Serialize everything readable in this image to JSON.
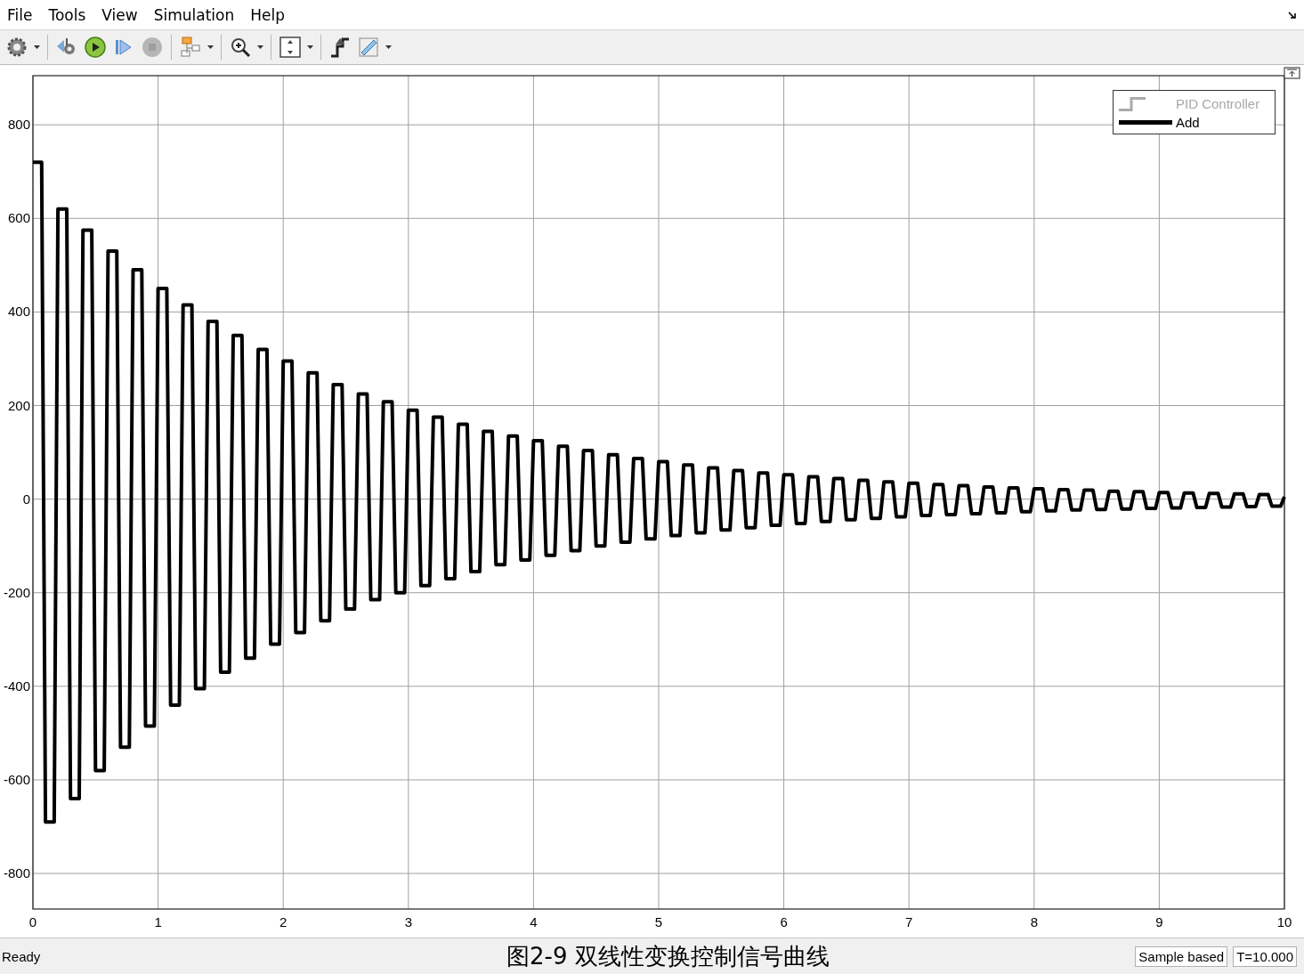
{
  "menu": [
    "File",
    "Tools",
    "View",
    "Simulation",
    "Help"
  ],
  "toolbar": [
    {
      "kind": "settings",
      "dropdown": true,
      "disabled": false
    },
    {
      "kind": "step-back",
      "dropdown": false,
      "disabled": false
    },
    {
      "kind": "run",
      "dropdown": false,
      "disabled": false
    },
    {
      "kind": "step-forward",
      "dropdown": false,
      "disabled": false
    },
    {
      "kind": "stop",
      "dropdown": false,
      "disabled": true
    },
    {
      "kind": "highlight",
      "dropdown": true,
      "disabled": false
    },
    {
      "kind": "zoom",
      "dropdown": true,
      "disabled": false
    },
    {
      "kind": "fit",
      "dropdown": true,
      "disabled": false
    },
    {
      "kind": "signal",
      "dropdown": false,
      "disabled": false
    },
    {
      "kind": "ruler",
      "dropdown": true,
      "disabled": false
    }
  ],
  "legend": [
    {
      "label": "PID Controller",
      "enabled": false
    }
  ],
  "plot": {
    "chart_data": {
      "type": "line",
      "grid": true,
      "xlim": [
        0,
        10
      ],
      "ylim": [
        -876,
        905
      ],
      "xticks": [
        0,
        1,
        2,
        3,
        4,
        5,
        6,
        7,
        8,
        9,
        10
      ],
      "yticks": [
        -800,
        -600,
        -400,
        -200,
        0,
        200,
        400,
        600,
        800
      ],
      "series": [
        {
          "name": "Add",
          "color": "#000000",
          "x": [
            0,
            0.07,
            0.1,
            0.17,
            0.2,
            0.27,
            0.3,
            0.37,
            0.4,
            0.47,
            0.5,
            0.57,
            0.6,
            0.67,
            0.7,
            0.77,
            0.8,
            0.87,
            0.9,
            0.97,
            1,
            1.07,
            1.1,
            1.17,
            1.2,
            1.27,
            1.3,
            1.37,
            1.4,
            1.47,
            1.5,
            1.57,
            1.6,
            1.67,
            1.7,
            1.77,
            1.8,
            1.87,
            1.9,
            1.97,
            2,
            2.07,
            2.1,
            2.17,
            2.2,
            2.27,
            2.3,
            2.37,
            2.4,
            2.47,
            2.5,
            2.57,
            2.6,
            2.67,
            2.7,
            2.77,
            2.8,
            2.87,
            2.9,
            2.97,
            3,
            3.07,
            3.1,
            3.17,
            3.2,
            3.27,
            3.3,
            3.37,
            3.4,
            3.47,
            3.5,
            3.57,
            3.6,
            3.67,
            3.7,
            3.77,
            3.8,
            3.87,
            3.9,
            3.97,
            4,
            4.07,
            4.1,
            4.17,
            4.2,
            4.27,
            4.3,
            4.37,
            4.4,
            4.47,
            4.5,
            4.57,
            4.6,
            4.67,
            4.7,
            4.77,
            4.8,
            4.87,
            4.9,
            4.97,
            5,
            5.07,
            5.1,
            5.17,
            5.2,
            5.27,
            5.3,
            5.37,
            5.4,
            5.47,
            5.5,
            5.57,
            5.6,
            5.67,
            5.7,
            5.77,
            5.8,
            5.87,
            5.9,
            5.97,
            6,
            6.07,
            6.1,
            6.17,
            6.2,
            6.27,
            6.3,
            6.37,
            6.4,
            6.47,
            6.5,
            6.57,
            6.6,
            6.67,
            6.7,
            6.77,
            6.8,
            6.87,
            6.9,
            6.97,
            7,
            7.07,
            7.1,
            7.17,
            7.2,
            7.27,
            7.3,
            7.37,
            7.4,
            7.47,
            7.5,
            7.57,
            7.6,
            7.67,
            7.7,
            7.77,
            7.8,
            7.87,
            7.9,
            7.97,
            8,
            8.07,
            8.1,
            8.17,
            8.2,
            8.27,
            8.3,
            8.37,
            8.4,
            8.47,
            8.5,
            8.57,
            8.6,
            8.67,
            8.7,
            8.77,
            8.8,
            8.87,
            8.9,
            8.97,
            9,
            9.07,
            9.1,
            9.17,
            9.2,
            9.27,
            9.3,
            9.37,
            9.4,
            9.47,
            9.5,
            9.57,
            9.6,
            9.67,
            9.7,
            9.77,
            9.8,
            9.87,
            9.9,
            9.97,
            10
          ],
          "values": [
            720,
            720,
            -690,
            -690,
            620,
            620,
            -640,
            -640,
            575,
            575,
            -580,
            -580,
            530,
            530,
            -530,
            -530,
            490,
            490,
            -485,
            -485,
            450,
            450,
            -440,
            -440,
            415,
            415,
            -405,
            -405,
            380,
            380,
            -370,
            -370,
            350,
            350,
            -340,
            -340,
            320,
            320,
            -310,
            -310,
            295,
            295,
            -285,
            -285,
            270,
            270,
            -260,
            -260,
            245,
            245,
            -235,
            -235,
            225,
            225,
            -215,
            -215,
            208,
            208,
            -200,
            -200,
            190,
            190,
            -185,
            -185,
            175,
            175,
            -170,
            -170,
            160,
            160,
            -155,
            -155,
            145,
            145,
            -140,
            -140,
            135,
            135,
            -130,
            -130,
            125,
            125,
            -120,
            -120,
            113,
            113,
            -110,
            -110,
            104,
            104,
            -100,
            -100,
            95,
            95,
            -92,
            -92,
            87,
            87,
            -85,
            -85,
            80,
            80,
            -78,
            -78,
            73,
            73,
            -72,
            -72,
            67,
            67,
            -66,
            -66,
            61,
            61,
            -61,
            -61,
            56,
            56,
            -56,
            -56,
            52,
            52,
            -52,
            -52,
            48,
            48,
            -48,
            -48,
            44,
            44,
            -44,
            -44,
            40,
            40,
            -41,
            -41,
            37,
            37,
            -38,
            -38,
            34,
            34,
            -35,
            -35,
            31,
            31,
            -33,
            -33,
            29,
            29,
            -31,
            -31,
            26,
            26,
            -29,
            -29,
            24,
            24,
            -27,
            -27,
            22,
            22,
            -25,
            -25,
            20,
            20,
            -23,
            -23,
            19,
            19,
            -22,
            -22,
            17,
            17,
            -21,
            -21,
            16,
            16,
            -20,
            -20,
            14,
            14,
            -19,
            -19,
            13,
            13,
            -18,
            -18,
            12,
            12,
            -17,
            -17,
            11,
            11,
            -16,
            -16,
            10,
            10,
            -15,
            -15,
            5
          ]
        }
      ]
    }
  },
  "caption": "图2-9 双线性变换控制信号曲线",
  "status": {
    "state": "Ready",
    "mode": "Sample based",
    "time": "T=10.000"
  }
}
